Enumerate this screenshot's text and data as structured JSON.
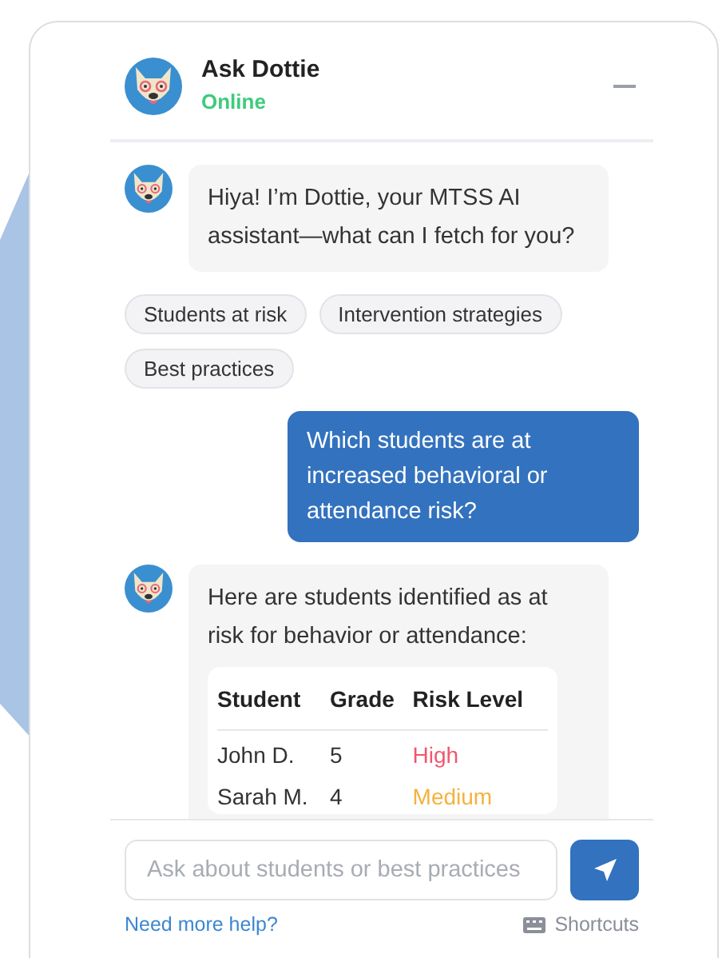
{
  "header": {
    "title": "Ask Dottie",
    "status": "Online",
    "online": true
  },
  "messages": [
    {
      "kind": "bot",
      "text": "Hiya! I’m Dottie, your MTSS AI assistant—what can I fetch for you?"
    },
    {
      "kind": "chips",
      "chips": [
        "Students at risk",
        "Intervention strategies",
        "Best practices"
      ]
    },
    {
      "kind": "user",
      "text": "Which students are at increased behavioral or attendance risk?"
    },
    {
      "kind": "bot",
      "text": "Here are students identified as at risk for behavior or attendance:",
      "table": {
        "columns": [
          "Student",
          "Grade",
          "Risk Level"
        ],
        "rows": [
          {
            "cells": [
              "John D.",
              "5",
              "High"
            ],
            "color": "#f0566f"
          },
          {
            "cells": [
              "Sarah M.",
              "4",
              "Medium"
            ],
            "color": "#f4b23e"
          }
        ]
      }
    }
  ],
  "composer": {
    "placeholder": "Ask about students or best practices"
  },
  "footer": {
    "help_link": "Need more help?",
    "shortcuts": "Shortcuts"
  }
}
